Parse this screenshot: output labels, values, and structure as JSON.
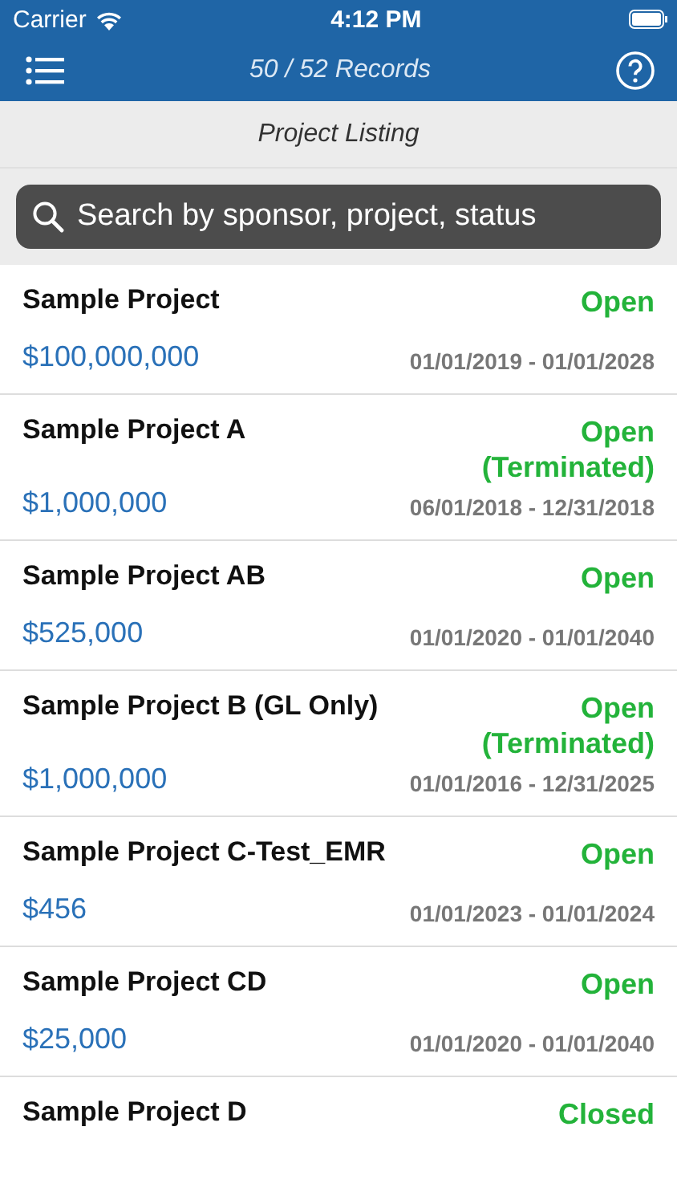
{
  "status_bar": {
    "carrier": "Carrier",
    "time": "4:12 PM"
  },
  "nav_bar": {
    "title": "50 / 52 Records"
  },
  "section_title": "Project Listing",
  "search": {
    "placeholder": "Search by sponsor, project, status"
  },
  "projects": [
    {
      "name": "Sample Project",
      "amount": "$100,000,000",
      "status": "Open",
      "dates": "01/01/2019 - 01/01/2028"
    },
    {
      "name": "Sample Project A",
      "amount": "$1,000,000",
      "status": "Open",
      "note": "(Terminated)",
      "dates": "06/01/2018 - 12/31/2018"
    },
    {
      "name": "Sample Project AB",
      "amount": "$525,000",
      "status": "Open",
      "dates": "01/01/2020 - 01/01/2040"
    },
    {
      "name": "Sample Project B (GL Only)",
      "amount": "$1,000,000",
      "status": "Open",
      "note": "(Terminated)",
      "dates": "01/01/2016 - 12/31/2025"
    },
    {
      "name": "Sample Project C-Test_EMR",
      "amount": "$456",
      "status": "Open",
      "dates": "01/01/2023 - 01/01/2024"
    },
    {
      "name": "Sample Project CD",
      "amount": "$25,000",
      "status": "Open",
      "dates": "01/01/2020 - 01/01/2040"
    },
    {
      "name": "Sample Project D",
      "status": "Closed"
    }
  ]
}
